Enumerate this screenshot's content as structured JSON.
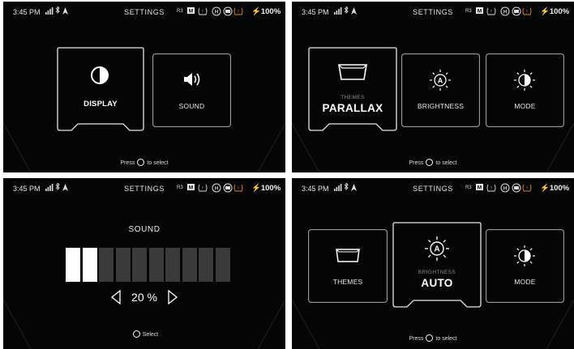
{
  "status": {
    "time": "3:45 PM",
    "title": "SETTINGS",
    "r3": "R3",
    "gear": "M",
    "battery": "100%",
    "icons": [
      "signal-icon",
      "bluetooth-icon",
      "navigation-icon",
      "tire-pressure-icon",
      "headlight-icon",
      "high-beam-icon",
      "warning-icon",
      "charging-bolt-icon"
    ]
  },
  "screen1": {
    "cards": [
      {
        "label": "DISPLAY",
        "icon": "contrast-icon"
      },
      {
        "label": "SOUND",
        "icon": "speaker-icon"
      }
    ],
    "hint_pre": "Press",
    "hint_post": "to select"
  },
  "screen2": {
    "themes_sub": "THEMES",
    "themes_value": "PARALLAX",
    "brightness_label": "BRIGHTNESS",
    "mode_label": "MODE",
    "hint_pre": "Press",
    "hint_post": "to select"
  },
  "screen3": {
    "title": "SOUND",
    "level_percent": 20,
    "level_text": "20 %",
    "bars_total": 10,
    "bars_filled": 2,
    "select_label": "Select"
  },
  "screen4": {
    "themes_label": "THEMES",
    "brightness_sub": "BRIGHTNESS",
    "brightness_value": "AUTO",
    "mode_label": "MODE",
    "auto_letter": "A",
    "hint_pre": "Press",
    "hint_post": "to select"
  },
  "colors": {
    "accent_green": "#3fd262",
    "warning_orange": "#e08a2a",
    "background": "#050505"
  }
}
